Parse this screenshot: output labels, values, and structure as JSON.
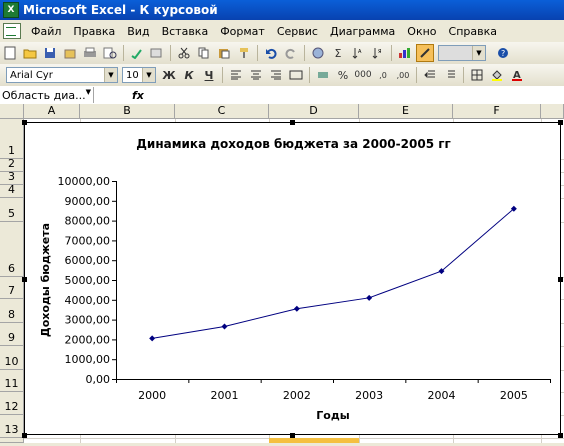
{
  "window": {
    "title": "Microsoft Excel - К курсовой",
    "app_icon": "excel-icon"
  },
  "menu": [
    "Файл",
    "Правка",
    "Вид",
    "Вставка",
    "Формат",
    "Сервис",
    "Диаграмма",
    "Окно",
    "Справка"
  ],
  "toolbar": {
    "font_name": "Arial Cyr",
    "font_size": "10",
    "bold": "Ж",
    "italic": "К",
    "underline": "Ч",
    "sigma": "Σ",
    "percent": "%"
  },
  "formula_bar": {
    "name_box": "Область диа...",
    "fx": "fx"
  },
  "columns": [
    "A",
    "B",
    "C",
    "D",
    "E",
    "F"
  ],
  "rows": [
    "1",
    "2",
    "3",
    "4",
    "5",
    "6",
    "7",
    "8",
    "9",
    "10",
    "11",
    "12",
    "13"
  ],
  "chart_data": {
    "type": "line",
    "title": "Динамика доходов бюджета за 2000-2005 гг",
    "xlabel": "Годы",
    "ylabel": "Доходы бюджета",
    "categories": [
      "2000",
      "2001",
      "2002",
      "2003",
      "2004",
      "2005"
    ],
    "values": [
      2050,
      2650,
      3550,
      4100,
      5450,
      8600
    ],
    "ylim": [
      0,
      10000
    ],
    "yticks": [
      "0,00",
      "1000,00",
      "2000,00",
      "3000,00",
      "4000,00",
      "5000,00",
      "6000,00",
      "7000,00",
      "8000,00",
      "9000,00",
      "10000,00"
    ],
    "series_color": "#000080",
    "grid": false
  }
}
